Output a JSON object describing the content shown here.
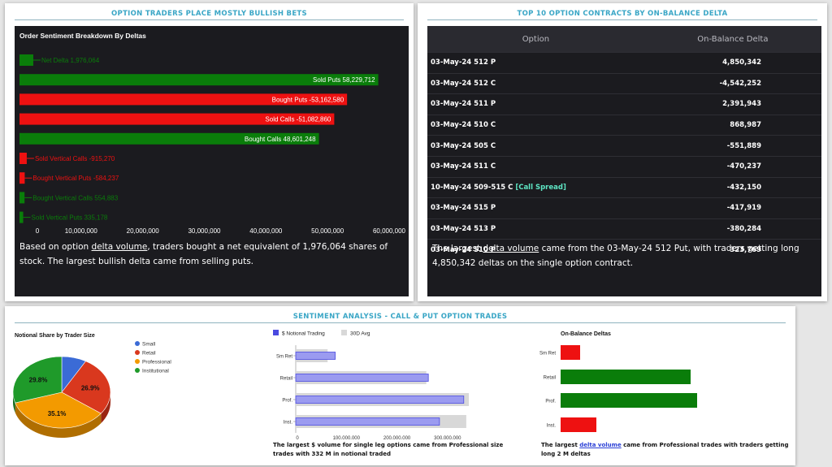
{
  "panel1": {
    "title": "OPTION TRADERS PLACE MOSTLY BULLISH BETS",
    "chart_title": "Order Sentiment Breakdown By Deltas",
    "caption_pre": "Based on option ",
    "caption_link": "delta volume",
    "caption_post": ", traders bought a net equivalent of 1,976,064 shares of stock. The largest bullish delta came from selling puts."
  },
  "panel2": {
    "title": "TOP 10 OPTION CONTRACTS BY ON-BALANCE DELTA",
    "col_option": "Option",
    "col_delta": "On-Balance Delta",
    "rows": [
      {
        "option": "03-May-24 512 P",
        "tag": "",
        "delta": "4,850,342"
      },
      {
        "option": "03-May-24 512 C",
        "tag": "",
        "delta": "-4,542,252"
      },
      {
        "option": "03-May-24 511 P",
        "tag": "",
        "delta": "2,391,943"
      },
      {
        "option": "03-May-24 510 C",
        "tag": "",
        "delta": "868,987"
      },
      {
        "option": "03-May-24 505 C",
        "tag": "",
        "delta": "-551,889"
      },
      {
        "option": "03-May-24 511 C",
        "tag": "",
        "delta": "-470,237"
      },
      {
        "option": "10-May-24 509-515 C",
        "tag": "[Call Spread]",
        "delta": "-432,150"
      },
      {
        "option": "03-May-24 515 P",
        "tag": "",
        "delta": "-417,919"
      },
      {
        "option": "03-May-24 513 P",
        "tag": "",
        "delta": "-380,284"
      },
      {
        "option": "03-May-24 510 P",
        "tag": "",
        "delta": "323,769"
      }
    ],
    "caption_pre": "The largest ",
    "caption_link": "delta volume",
    "caption_post": " came from the 03-May-24 512 Put, with traders getting long 4,850,342 deltas on the single option contract."
  },
  "panel3": {
    "title": "SENTIMENT ANALYSIS - CALL & PUT OPTION TRADES",
    "notional_caption": "The largest $ volume for single leg options came from Professional size trades with 332 M in notional traded",
    "obd_caption_pre": "The largest ",
    "obd_caption_link": "delta volume",
    "obd_caption_post": " came from Professional trades with traders getting long 2 M deltas"
  },
  "colors": {
    "green": "#0a7d0a",
    "red": "#ee1111",
    "small": "#3b6bd6",
    "retail": "#d9381e",
    "professional": "#f39a00",
    "institutional": "#1f9a2a",
    "notional_bar": "#9b9bf0",
    "avg_bar": "#d8d8d8"
  },
  "chart_data": [
    {
      "type": "bar",
      "orientation": "horizontal",
      "title": "Order Sentiment Breakdown By Deltas",
      "categories": [
        "Net Delta",
        "Sold Puts",
        "Bought Puts",
        "Sold Calls",
        "Bought Calls",
        "Sold Vertical Calls",
        "Bought Vertical Puts",
        "Bought Vertical Calls",
        "Sold Vertical Puts"
      ],
      "values": [
        1976064,
        58229712,
        -53162580,
        -51082860,
        48601248,
        -915270,
        -584237,
        554883,
        335178
      ],
      "labels": [
        "Net Delta 1,976,064",
        "Sold Puts 58,229,712",
        "Bought Puts -53,162,580",
        "Sold Calls -51,082,860",
        "Bought Calls 48,601,248",
        "Sold Vertical Calls -915,270",
        "Bought Vertical Puts -584,237",
        "Bought Vertical Calls 554,883",
        "Sold Vertical Puts 335,178"
      ],
      "xlim": [
        0,
        60000000
      ],
      "xticks": [
        "0",
        "10,000,000",
        "20,000,000",
        "30,000,000",
        "40,000,000",
        "50,000,000",
        "60,000,000"
      ]
    },
    {
      "type": "pie",
      "title": "Notional Share by Trader Size",
      "categories": [
        "Small",
        "Retail",
        "Professional",
        "Institutional"
      ],
      "values": [
        8.2,
        26.9,
        35.1,
        29.8
      ],
      "labels": [
        "",
        "26.9%",
        "35.1%",
        "29.8%"
      ],
      "legend": "right"
    },
    {
      "type": "bar",
      "orientation": "horizontal",
      "categories": [
        "Sm Ret",
        "Retail",
        "Prof.",
        "Inst."
      ],
      "series": [
        {
          "name": "$ Notional Trading",
          "values": [
            78000000,
            262000000,
            332000000,
            284000000
          ]
        },
        {
          "name": "30D Avg",
          "values": [
            63000000,
            258000000,
            342000000,
            337000000
          ]
        }
      ],
      "xlim": [
        0,
        350000000
      ],
      "xticks": [
        "0",
        "100,000,000",
        "200,000,000",
        "300,000,000"
      ],
      "legend": "top"
    },
    {
      "type": "bar",
      "orientation": "horizontal",
      "title": "On-Balance Deltas",
      "categories": [
        "Sm Ret",
        "Retail",
        "Prof.",
        "Inst."
      ],
      "values": [
        -0.3,
        2.0,
        2.1,
        -0.55
      ]
    }
  ]
}
